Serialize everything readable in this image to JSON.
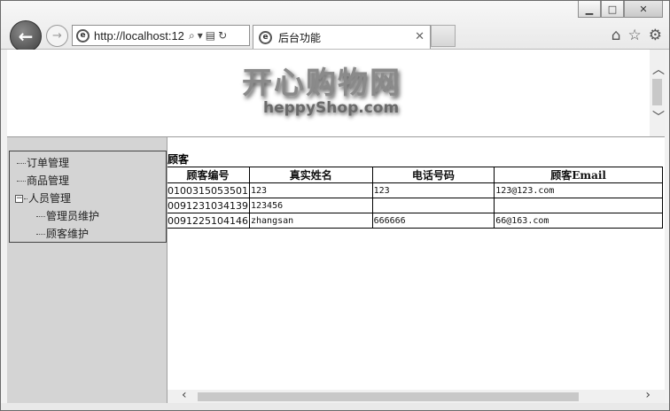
{
  "browser": {
    "address_text": "http://localhost:12",
    "tab_label": "后台功能",
    "window_buttons": [
      "minimize-icon",
      "maximize-icon",
      "close-icon"
    ],
    "right_tools": [
      "home-icon",
      "star-icon",
      "gear-icon"
    ]
  },
  "banner": {
    "logo_text": "开心购物网",
    "logo_subtitle": "heppyShop.com"
  },
  "sidebar": {
    "items": [
      {
        "label": "订单管理",
        "level": 1
      },
      {
        "label": "商品管理",
        "level": 1
      },
      {
        "label": "人员管理",
        "level": 1,
        "expanded": true
      },
      {
        "label": "管理员维护",
        "level": 2
      },
      {
        "label": "顾客维护",
        "level": 2
      }
    ]
  },
  "main": {
    "title": "理顾客",
    "table": {
      "headers": [
        "顾客编号",
        "真实姓名",
        "电话号码",
        "顾客Email"
      ],
      "rows": [
        [
          "0100315053501",
          "123",
          "123",
          "123@123.com"
        ],
        [
          "0091231034139",
          "123456",
          "",
          ""
        ],
        [
          "0091225104146",
          "zhangsan",
          "666666",
          "66@163.com"
        ]
      ]
    }
  }
}
